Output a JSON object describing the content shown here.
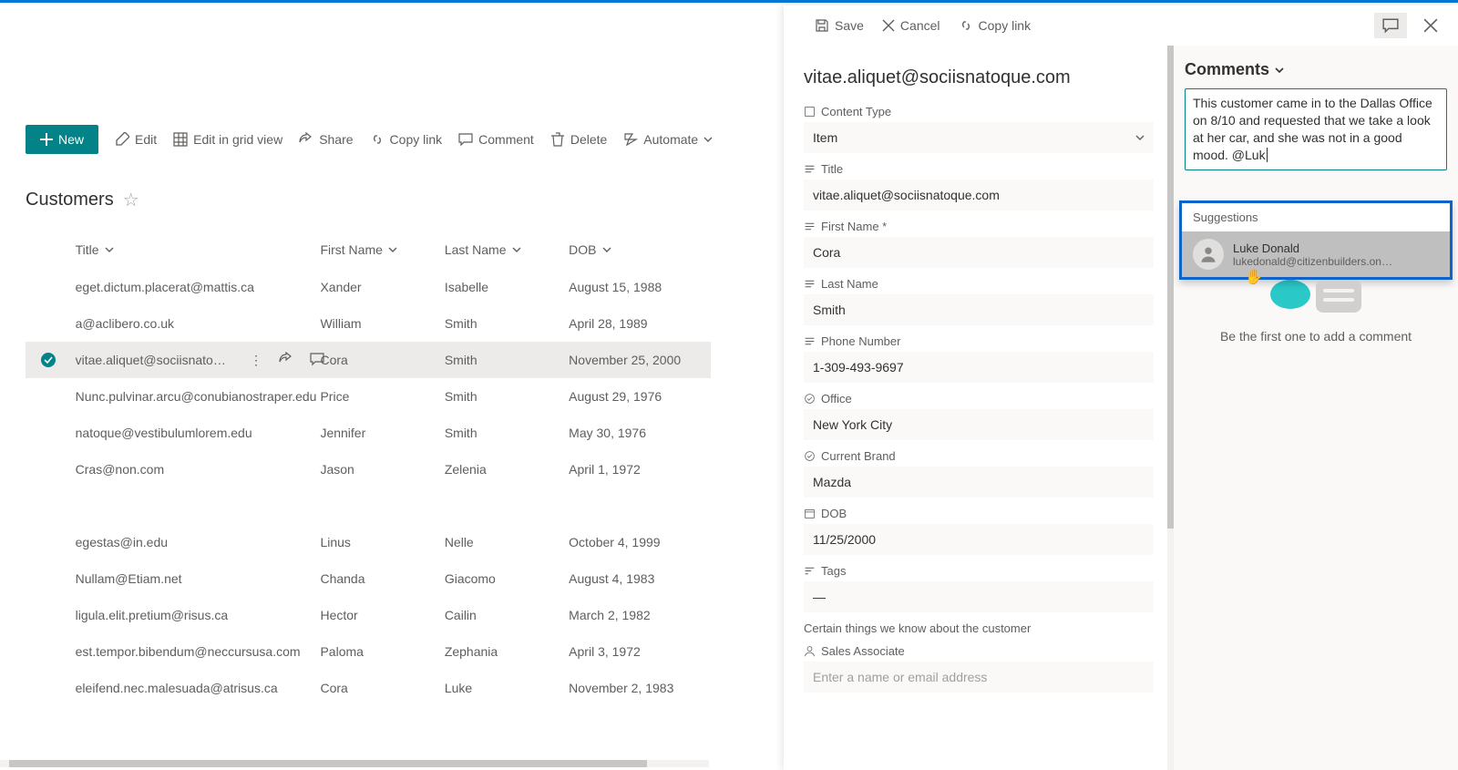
{
  "cmd": {
    "new": "New",
    "edit": "Edit",
    "grid": "Edit in grid view",
    "share": "Share",
    "copy": "Copy link",
    "comment": "Comment",
    "delete": "Delete",
    "automate": "Automate"
  },
  "list": {
    "title": "Customers",
    "columns": {
      "title": "Title",
      "first_name": "First Name",
      "last_name": "Last Name",
      "dob": "DOB"
    }
  },
  "rows": [
    {
      "title": "eget.dictum.placerat@mattis.ca",
      "fn": "Xander",
      "ln": "Isabelle",
      "dob": "August 15, 1988"
    },
    {
      "title": "a@aclibero.co.uk",
      "fn": "William",
      "ln": "Smith",
      "dob": "April 28, 1989"
    },
    {
      "title": "vitae.aliquet@sociisnato…",
      "fn": "Cora",
      "ln": "Smith",
      "dob": "November 25, 2000",
      "selected": true
    },
    {
      "title": "Nunc.pulvinar.arcu@conubianostraper.edu",
      "fn": "Price",
      "ln": "Smith",
      "dob": "August 29, 1976"
    },
    {
      "title": "natoque@vestibulumlorem.edu",
      "fn": "Jennifer",
      "ln": "Smith",
      "dob": "May 30, 1976"
    },
    {
      "title": "Cras@non.com",
      "fn": "Jason",
      "ln": "Zelenia",
      "dob": "April 1, 1972"
    },
    {
      "title": "egestas@in.edu",
      "fn": "Linus",
      "ln": "Nelle",
      "dob": "October 4, 1999"
    },
    {
      "title": "Nullam@Etiam.net",
      "fn": "Chanda",
      "ln": "Giacomo",
      "dob": "August 4, 1983"
    },
    {
      "title": "ligula.elit.pretium@risus.ca",
      "fn": "Hector",
      "ln": "Cailin",
      "dob": "March 2, 1982"
    },
    {
      "title": "est.tempor.bibendum@neccursusa.com",
      "fn": "Paloma",
      "ln": "Zephania",
      "dob": "April 3, 1972"
    },
    {
      "title": "eleifend.nec.malesuada@atrisus.ca",
      "fn": "Cora",
      "ln": "Luke",
      "dob": "November 2, 1983"
    }
  ],
  "pane": {
    "save": "Save",
    "cancel": "Cancel",
    "copy": "Copy link",
    "item_title": "vitae.aliquet@sociisnatoque.com",
    "fields": {
      "content_type": {
        "label": "Content Type",
        "value": "Item"
      },
      "title": {
        "label": "Title",
        "value": "vitae.aliquet@sociisnatoque.com"
      },
      "first_name": {
        "label": "First Name *",
        "value": "Cora"
      },
      "last_name": {
        "label": "Last Name",
        "value": "Smith"
      },
      "phone": {
        "label": "Phone Number",
        "value": "1-309-493-9697"
      },
      "office": {
        "label": "Office",
        "value": "New York City"
      },
      "brand": {
        "label": "Current Brand",
        "value": "Mazda"
      },
      "dob": {
        "label": "DOB",
        "value": "11/25/2000"
      },
      "tags": {
        "label": "Tags",
        "value": "—"
      },
      "section": "Certain things we know about the customer",
      "sales": {
        "label": "Sales Associate",
        "placeholder": "Enter a name or email address"
      }
    }
  },
  "comments": {
    "header": "Comments",
    "textbox": "This customer came in to the Dallas Office on 8/10 and requested that we take a look at her car, and she was not in a good mood. @Luk",
    "suggestions_label": "Suggestions",
    "suggestion": {
      "name": "Luke Donald",
      "email": "lukedonald@citizenbuilders.onmic…"
    },
    "empty": "Be the first one to add a comment"
  }
}
